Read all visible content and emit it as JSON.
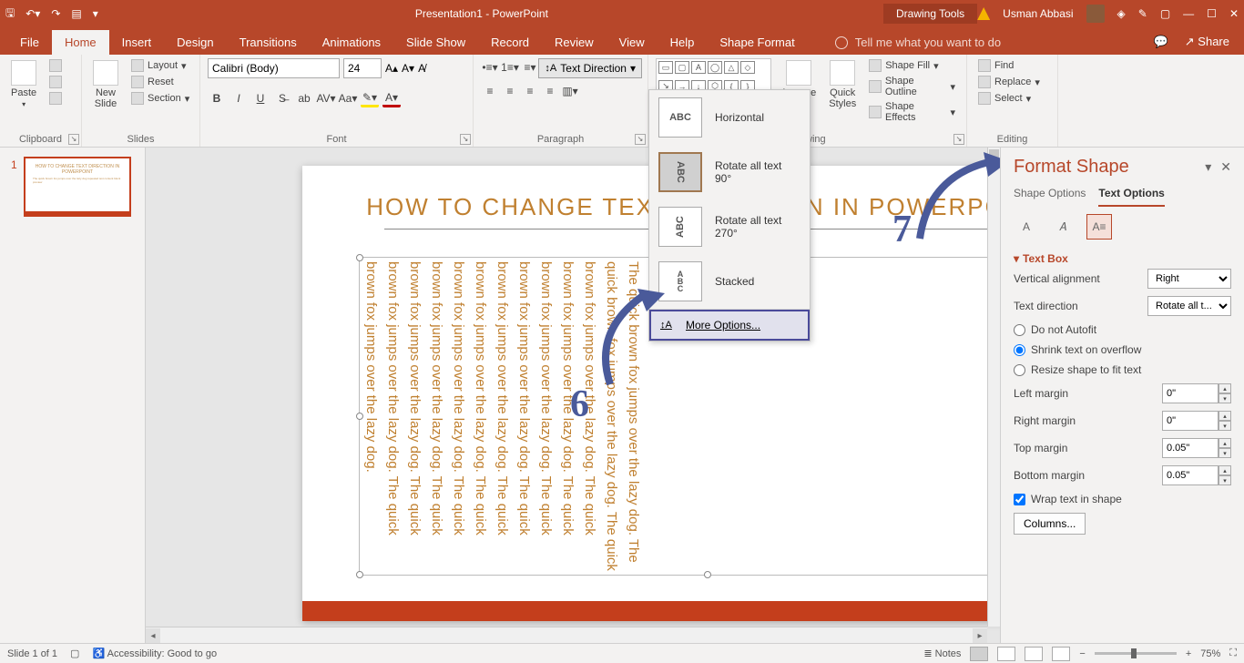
{
  "titlebar": {
    "doc_title": "Presentation1 - PowerPoint",
    "context_tab": "Drawing Tools",
    "user_name": "Usman Abbasi"
  },
  "tabs": {
    "items": [
      "File",
      "Home",
      "Insert",
      "Design",
      "Transitions",
      "Animations",
      "Slide Show",
      "Record",
      "Review",
      "View",
      "Help",
      "Shape Format"
    ],
    "active": "Home",
    "tellme": "Tell me what you want to do",
    "share": "Share"
  },
  "ribbon": {
    "clipboard": {
      "paste": "Paste",
      "label": "Clipboard"
    },
    "slides": {
      "new_slide": "New\nSlide",
      "layout": "Layout",
      "reset": "Reset",
      "section": "Section",
      "label": "Slides"
    },
    "font": {
      "name": "Calibri (Body)",
      "size": "24",
      "label": "Font"
    },
    "paragraph": {
      "text_direction": "Text Direction",
      "label": "Paragraph"
    },
    "drawing": {
      "arrange": "Arrange",
      "quick_styles": "Quick\nStyles",
      "shape_fill": "Shape Fill",
      "shape_outline": "Shape Outline",
      "shape_effects": "Shape Effects",
      "label": "Drawing"
    },
    "editing": {
      "find": "Find",
      "replace": "Replace",
      "select": "Select",
      "label": "Editing"
    }
  },
  "dropdown": {
    "horizontal": "Horizontal",
    "rotate90": "Rotate all text 90°",
    "rotate270": "Rotate all text 270°",
    "stacked": "Stacked",
    "more": "More Options..."
  },
  "slide": {
    "number": "1",
    "title": "HOW TO  CHANGE  TEXT DIRECTION IN POWERPOINT",
    "body": "The quick brown fox jumps over the lazy dog. The quick brown fox jumps over the lazy dog. The quick brown fox jumps over the lazy dog. The quick brown fox jumps over the lazy dog. The quick brown fox jumps over the lazy dog. The quick brown fox jumps over the lazy dog. The quick brown fox jumps over the lazy dog. The quick brown fox jumps over the lazy dog. The quick brown fox jumps over the lazy dog. The quick brown fox jumps over the lazy dog. The quick brown fox jumps over the lazy dog. The quick brown fox jumps over the lazy dog. The quick brown fox jumps over the lazy dog."
  },
  "annotations": {
    "six": "6",
    "seven": "7"
  },
  "pane": {
    "title": "Format Shape",
    "tab_shape": "Shape Options",
    "tab_text": "Text Options",
    "section": "Text Box",
    "valign_label": "Vertical alignment",
    "valign_value": "Right",
    "tdir_label": "Text direction",
    "tdir_value": "Rotate all t...",
    "opt_noautofit": "Do not Autofit",
    "opt_shrink": "Shrink text on overflow",
    "opt_resize": "Resize shape to fit text",
    "lm_label": "Left margin",
    "lm_val": "0\"",
    "rm_label": "Right margin",
    "rm_val": "0\"",
    "tm_label": "Top margin",
    "tm_val": "0.05\"",
    "bm_label": "Bottom margin",
    "bm_val": "0.05\"",
    "wrap": "Wrap text in shape",
    "columns": "Columns..."
  },
  "statusbar": {
    "slide_info": "Slide 1 of 1",
    "accessibility": "Accessibility: Good to go",
    "notes": "Notes",
    "zoom": "75%"
  }
}
